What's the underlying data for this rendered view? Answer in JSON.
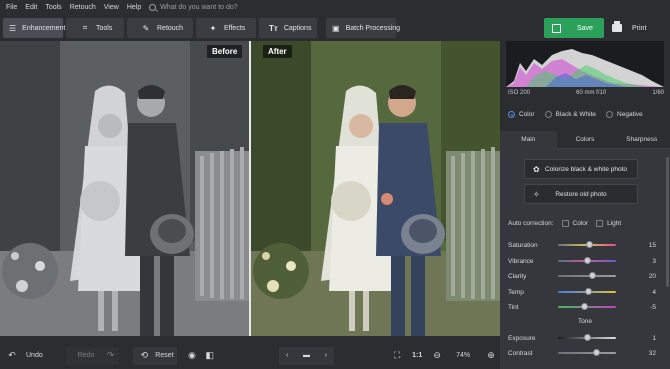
{
  "menu": {
    "items": [
      "File",
      "Edit",
      "Tools",
      "Retouch",
      "View",
      "Help"
    ],
    "search_placeholder": "What do you want to do?"
  },
  "toolbar": {
    "tabs": [
      {
        "label": "Enhancement",
        "icon": "sliders-icon"
      },
      {
        "label": "Tools",
        "icon": "crop-icon"
      },
      {
        "label": "Retouch",
        "icon": "brush-icon"
      },
      {
        "label": "Effects",
        "icon": "magic-wand-icon"
      },
      {
        "label": "Captions",
        "icon": "text-icon"
      }
    ],
    "batch_label": "Batch Processing",
    "save_label": "Save",
    "print_label": "Print",
    "save_color": "#2aa05a"
  },
  "canvas": {
    "before_label": "Before",
    "after_label": "After"
  },
  "bottom": {
    "undo_label": "Undo",
    "redo_label": "Redo",
    "reset_label": "Reset",
    "ratio_label": "1:1",
    "zoom_value": "74%"
  },
  "panel": {
    "exif": {
      "iso": "ISO 200",
      "lens": "60 mm f/10",
      "shutter": "1/60"
    },
    "modes": [
      "Color",
      "Black & White",
      "Negative"
    ],
    "selected_mode": "Color",
    "tabs": [
      "Main",
      "Colors",
      "Sharpness"
    ],
    "colorize_label": "Colorize black & white photo",
    "restore_label": "Restore old photo",
    "auto_correction_label": "Auto correction:",
    "auto_color_label": "Color",
    "auto_light_label": "Light",
    "sliders": [
      {
        "label": "Saturation",
        "value": "15",
        "pos": 0.56,
        "track": "linear-gradient(90deg,#6e7078,#d4c25a,#e04a8a)"
      },
      {
        "label": "Vibrance",
        "value": "3",
        "pos": 0.52,
        "track": "linear-gradient(90deg,#5a6f8a,#c05a9c,#6a5acf)"
      },
      {
        "label": "Clarity",
        "value": "20",
        "pos": 0.6,
        "track": "linear-gradient(90deg,#6e7078,#9a9ca3)"
      },
      {
        "label": "Temp",
        "value": "4",
        "pos": 0.53,
        "track": "linear-gradient(90deg,#3f7fe0,#e0c040)"
      },
      {
        "label": "Tint",
        "value": "-5",
        "pos": 0.47,
        "track": "linear-gradient(90deg,#3fc060,#c040c0)"
      }
    ],
    "tone_label": "Tone",
    "tone_sliders": [
      {
        "label": "Exposure",
        "value": "1",
        "pos": 0.51,
        "track": "linear-gradient(90deg,#1a1a1a,#e0e0e0)"
      },
      {
        "label": "Contrast",
        "value": "32",
        "pos": 0.68,
        "track": "linear-gradient(90deg,#6e7078,#9a9ca3)"
      }
    ]
  }
}
